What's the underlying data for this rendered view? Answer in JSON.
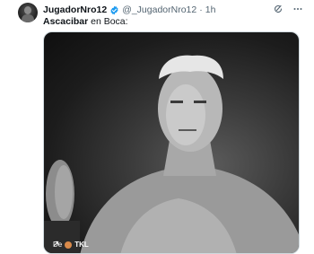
{
  "tweet": {
    "display_name": "JugadorNro12",
    "handle": "@_JugadorNro12",
    "separator": "·",
    "timestamp": "1h",
    "text_bold": "Ascacibar",
    "text_rest": " en Boca:",
    "icons": {
      "avatar": "avatar-image",
      "verified": "verified-badge-icon",
      "grok": "grok-icon",
      "more": "more-options-icon"
    },
    "colors": {
      "verified": "#1d9bf0",
      "secondary_text": "#536471"
    }
  },
  "media": {
    "description_icon": "video-thumbnail",
    "attribution_prefix": "De",
    "attribution_name": "TKL",
    "attribution_icon": "share-arrow-icon"
  }
}
